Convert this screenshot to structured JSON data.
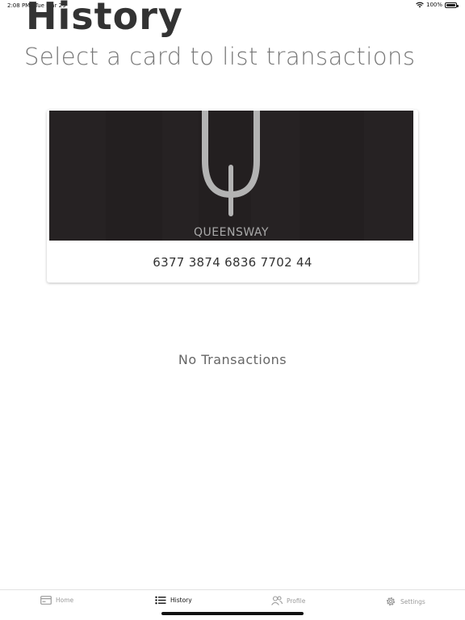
{
  "status_bar": {
    "time": "2:08 PM",
    "date": "Tue Mar 29",
    "battery": "100%"
  },
  "header": {
    "title": "History",
    "subtitle": "Select a card to list transactions"
  },
  "card": {
    "brand": "QUEENSWAY",
    "number": "6377 3874 6836 7702 44"
  },
  "transactions": {
    "empty_message": "No Transactions"
  },
  "tabs": [
    {
      "label": "Home",
      "icon": "card-icon",
      "active": false
    },
    {
      "label": "History",
      "icon": "list-icon",
      "active": true
    },
    {
      "label": "Profile",
      "icon": "users-icon",
      "active": false
    },
    {
      "label": "Settings",
      "icon": "gear-icon",
      "active": false
    }
  ]
}
